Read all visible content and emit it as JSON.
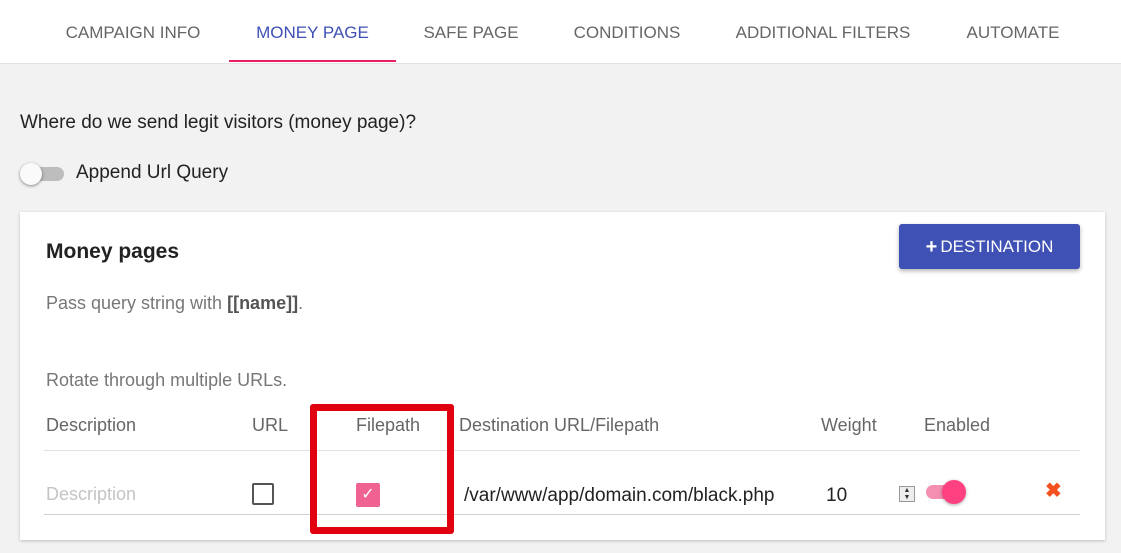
{
  "tabs": [
    {
      "label": "CAMPAIGN INFO"
    },
    {
      "label": "MONEY PAGE"
    },
    {
      "label": "SAFE PAGE"
    },
    {
      "label": "CONDITIONS"
    },
    {
      "label": "ADDITIONAL FILTERS"
    },
    {
      "label": "AUTOMATE"
    }
  ],
  "active_tab": "MONEY PAGE",
  "question": "Where do we send legit visitors (money page)?",
  "append_toggle": {
    "label": "Append Url Query",
    "on": false
  },
  "card": {
    "title": "Money pages",
    "add_button": {
      "icon": "plus-icon",
      "label": "DESTINATION"
    },
    "hint_prefix": "Pass query string with ",
    "hint_token": "[[name]]",
    "hint_suffix": ".",
    "rotate_hint": "Rotate through multiple URLs.",
    "columns": [
      "Description",
      "URL",
      "Filepath",
      "Destination URL/Filepath",
      "Weight",
      "Enabled"
    ],
    "rows": [
      {
        "description_placeholder": "Description",
        "description_value": "",
        "url_checked": false,
        "filepath_checked": true,
        "destination": "/var/www/app/domain.com/black.php",
        "weight": "10",
        "enabled": true,
        "remove_icon": "close-icon"
      }
    ]
  },
  "colors": {
    "accent": "#3f51b5",
    "pink": "#e91e63",
    "highlight": "#e0000f",
    "remove": "#f4511e"
  }
}
